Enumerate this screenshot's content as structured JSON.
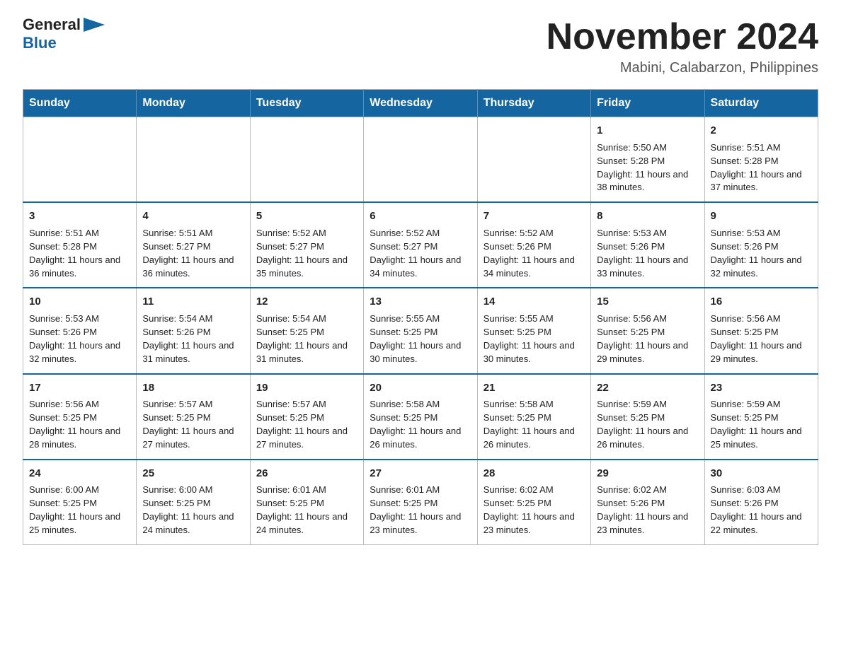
{
  "header": {
    "logo_general": "General",
    "logo_blue": "Blue",
    "month_title": "November 2024",
    "location": "Mabini, Calabarzon, Philippines"
  },
  "weekdays": [
    "Sunday",
    "Monday",
    "Tuesday",
    "Wednesday",
    "Thursday",
    "Friday",
    "Saturday"
  ],
  "weeks": [
    [
      {
        "day": "",
        "info": ""
      },
      {
        "day": "",
        "info": ""
      },
      {
        "day": "",
        "info": ""
      },
      {
        "day": "",
        "info": ""
      },
      {
        "day": "",
        "info": ""
      },
      {
        "day": "1",
        "info": "Sunrise: 5:50 AM\nSunset: 5:28 PM\nDaylight: 11 hours and 38 minutes."
      },
      {
        "day": "2",
        "info": "Sunrise: 5:51 AM\nSunset: 5:28 PM\nDaylight: 11 hours and 37 minutes."
      }
    ],
    [
      {
        "day": "3",
        "info": "Sunrise: 5:51 AM\nSunset: 5:28 PM\nDaylight: 11 hours and 36 minutes."
      },
      {
        "day": "4",
        "info": "Sunrise: 5:51 AM\nSunset: 5:27 PM\nDaylight: 11 hours and 36 minutes."
      },
      {
        "day": "5",
        "info": "Sunrise: 5:52 AM\nSunset: 5:27 PM\nDaylight: 11 hours and 35 minutes."
      },
      {
        "day": "6",
        "info": "Sunrise: 5:52 AM\nSunset: 5:27 PM\nDaylight: 11 hours and 34 minutes."
      },
      {
        "day": "7",
        "info": "Sunrise: 5:52 AM\nSunset: 5:26 PM\nDaylight: 11 hours and 34 minutes."
      },
      {
        "day": "8",
        "info": "Sunrise: 5:53 AM\nSunset: 5:26 PM\nDaylight: 11 hours and 33 minutes."
      },
      {
        "day": "9",
        "info": "Sunrise: 5:53 AM\nSunset: 5:26 PM\nDaylight: 11 hours and 32 minutes."
      }
    ],
    [
      {
        "day": "10",
        "info": "Sunrise: 5:53 AM\nSunset: 5:26 PM\nDaylight: 11 hours and 32 minutes."
      },
      {
        "day": "11",
        "info": "Sunrise: 5:54 AM\nSunset: 5:26 PM\nDaylight: 11 hours and 31 minutes."
      },
      {
        "day": "12",
        "info": "Sunrise: 5:54 AM\nSunset: 5:25 PM\nDaylight: 11 hours and 31 minutes."
      },
      {
        "day": "13",
        "info": "Sunrise: 5:55 AM\nSunset: 5:25 PM\nDaylight: 11 hours and 30 minutes."
      },
      {
        "day": "14",
        "info": "Sunrise: 5:55 AM\nSunset: 5:25 PM\nDaylight: 11 hours and 30 minutes."
      },
      {
        "day": "15",
        "info": "Sunrise: 5:56 AM\nSunset: 5:25 PM\nDaylight: 11 hours and 29 minutes."
      },
      {
        "day": "16",
        "info": "Sunrise: 5:56 AM\nSunset: 5:25 PM\nDaylight: 11 hours and 29 minutes."
      }
    ],
    [
      {
        "day": "17",
        "info": "Sunrise: 5:56 AM\nSunset: 5:25 PM\nDaylight: 11 hours and 28 minutes."
      },
      {
        "day": "18",
        "info": "Sunrise: 5:57 AM\nSunset: 5:25 PM\nDaylight: 11 hours and 27 minutes."
      },
      {
        "day": "19",
        "info": "Sunrise: 5:57 AM\nSunset: 5:25 PM\nDaylight: 11 hours and 27 minutes."
      },
      {
        "day": "20",
        "info": "Sunrise: 5:58 AM\nSunset: 5:25 PM\nDaylight: 11 hours and 26 minutes."
      },
      {
        "day": "21",
        "info": "Sunrise: 5:58 AM\nSunset: 5:25 PM\nDaylight: 11 hours and 26 minutes."
      },
      {
        "day": "22",
        "info": "Sunrise: 5:59 AM\nSunset: 5:25 PM\nDaylight: 11 hours and 26 minutes."
      },
      {
        "day": "23",
        "info": "Sunrise: 5:59 AM\nSunset: 5:25 PM\nDaylight: 11 hours and 25 minutes."
      }
    ],
    [
      {
        "day": "24",
        "info": "Sunrise: 6:00 AM\nSunset: 5:25 PM\nDaylight: 11 hours and 25 minutes."
      },
      {
        "day": "25",
        "info": "Sunrise: 6:00 AM\nSunset: 5:25 PM\nDaylight: 11 hours and 24 minutes."
      },
      {
        "day": "26",
        "info": "Sunrise: 6:01 AM\nSunset: 5:25 PM\nDaylight: 11 hours and 24 minutes."
      },
      {
        "day": "27",
        "info": "Sunrise: 6:01 AM\nSunset: 5:25 PM\nDaylight: 11 hours and 23 minutes."
      },
      {
        "day": "28",
        "info": "Sunrise: 6:02 AM\nSunset: 5:25 PM\nDaylight: 11 hours and 23 minutes."
      },
      {
        "day": "29",
        "info": "Sunrise: 6:02 AM\nSunset: 5:26 PM\nDaylight: 11 hours and 23 minutes."
      },
      {
        "day": "30",
        "info": "Sunrise: 6:03 AM\nSunset: 5:26 PM\nDaylight: 11 hours and 22 minutes."
      }
    ]
  ]
}
